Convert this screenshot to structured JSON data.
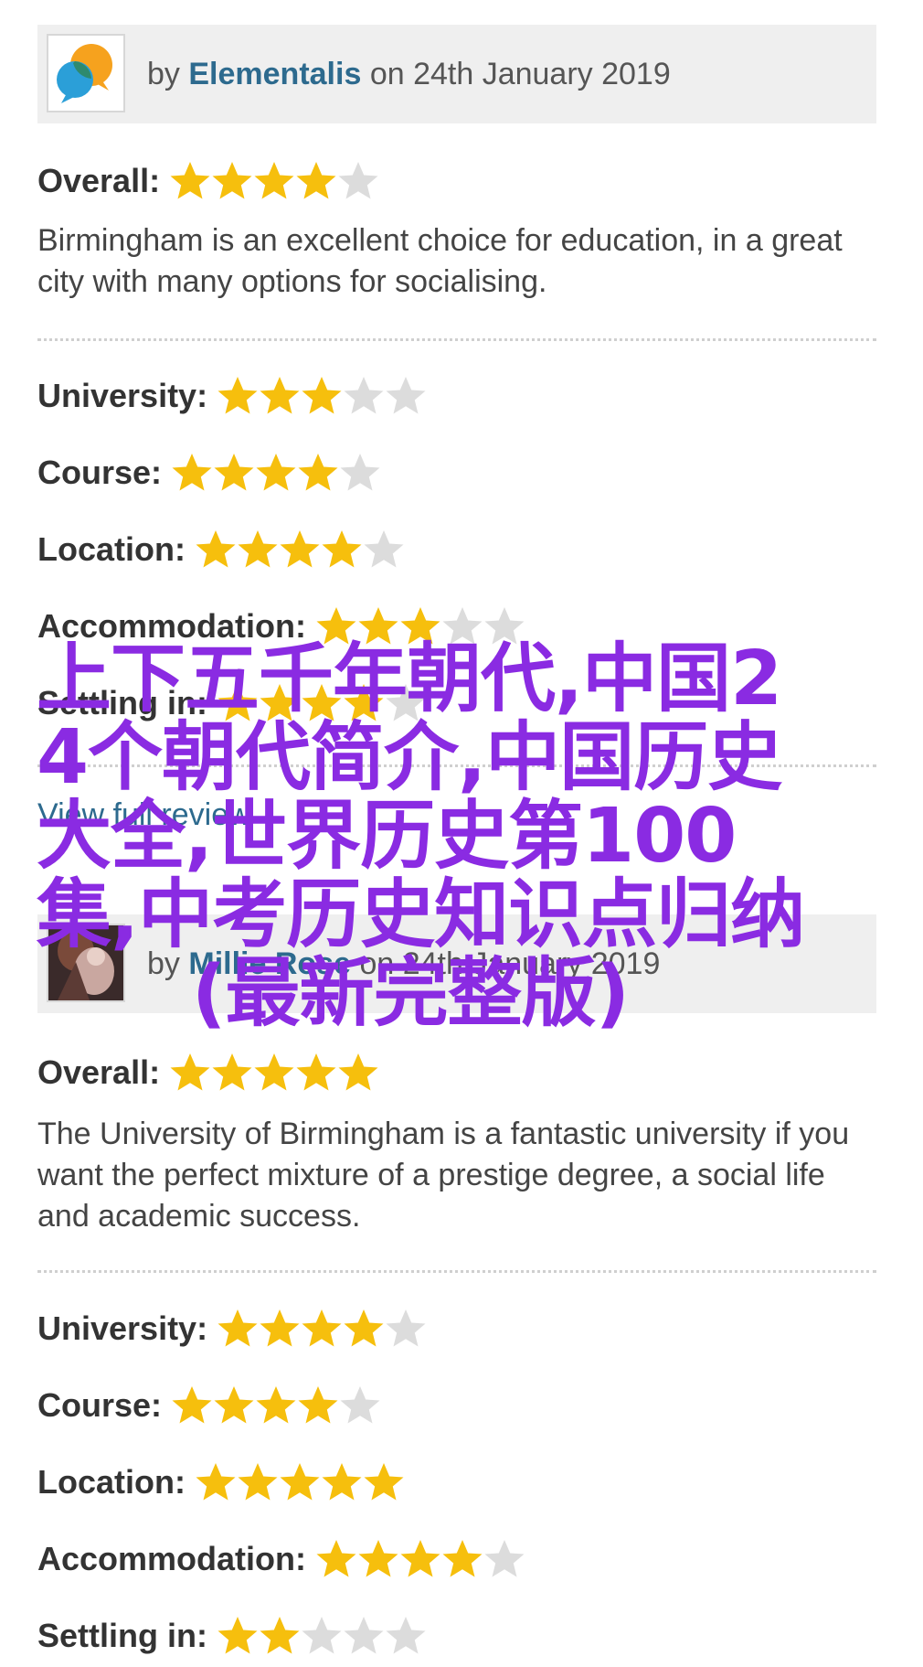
{
  "colors": {
    "header_bg": "#efefef",
    "author_link": "#2d6a8e",
    "star_filled": "#f6bf0d",
    "star_empty": "#dcdcdc",
    "overlay_text": "#8a2be2"
  },
  "reviews": [
    {
      "avatar_icon": "speech-bubbles-logo-icon",
      "by": "by",
      "author": "Elementalis",
      "on_date": "on 24th January 2019",
      "overall": {
        "label": "Overall:",
        "stars": 4,
        "max": 5
      },
      "text": "Birmingham is an excellent choice for education, in a great city with many options for socialising.",
      "ratings": [
        {
          "label": "University:",
          "stars": 3,
          "max": 5
        },
        {
          "label": "Course:",
          "stars": 4,
          "max": 5
        },
        {
          "label": "Location:",
          "stars": 4,
          "max": 5
        },
        {
          "label": "Accommodation:",
          "stars": 3,
          "max": 5
        },
        {
          "label": "Settling in:",
          "stars": 4,
          "max": 5
        }
      ],
      "view_full": "View full review"
    },
    {
      "avatar_icon": "user-photo-avatar",
      "by": "by",
      "author": "Millie Rose",
      "on_date": "on 24th January 2019",
      "overall": {
        "label": "Overall:",
        "stars": 5,
        "max": 5
      },
      "text": "The University of Birmingham is a fantastic university if you want the perfect mixture of a prestige degree, a social life and academic success.",
      "ratings": [
        {
          "label": "University:",
          "stars": 4,
          "max": 5
        },
        {
          "label": "Course:",
          "stars": 4,
          "max": 5
        },
        {
          "label": "Location:",
          "stars": 5,
          "max": 5
        },
        {
          "label": "Accommodation:",
          "stars": 4,
          "max": 5
        },
        {
          "label": "Settling in:",
          "stars": 2,
          "max": 5
        }
      ]
    }
  ],
  "overlay": {
    "lines": [
      "上下五千年朝代,中国2",
      "4个朝代简介,中国历史",
      "大全,世界历史第100",
      "集,中考历史知识点归纳",
      "(最新完整版)"
    ]
  }
}
